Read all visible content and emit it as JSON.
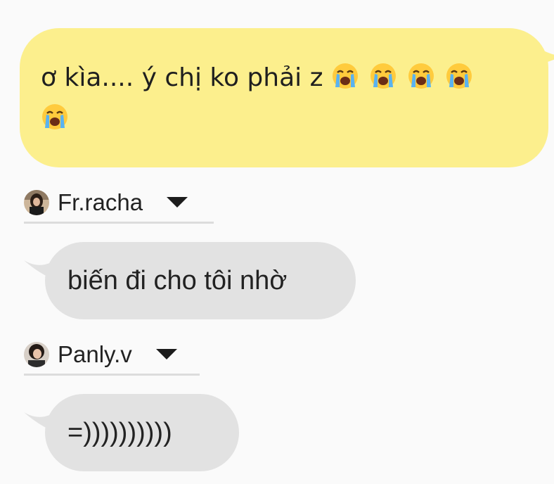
{
  "messages": {
    "outgoing": {
      "text": "ơ kìa.... ý chị ko phải z",
      "emojis": [
        "loudly-crying-face",
        "loudly-crying-face",
        "loudly-crying-face",
        "loudly-crying-face",
        "loudly-crying-face"
      ],
      "bubble_color": "#fcef8d"
    },
    "incoming": [
      {
        "sender": "Fr.racha",
        "avatar_icon": "avatar-fr-racha",
        "text": "biến đi cho tôi nhờ"
      },
      {
        "sender": "Panly.v",
        "avatar_icon": "avatar-panly-v",
        "text": "=))))))))))"
      }
    ],
    "incoming_bubble_color": "#e2e2e2"
  }
}
